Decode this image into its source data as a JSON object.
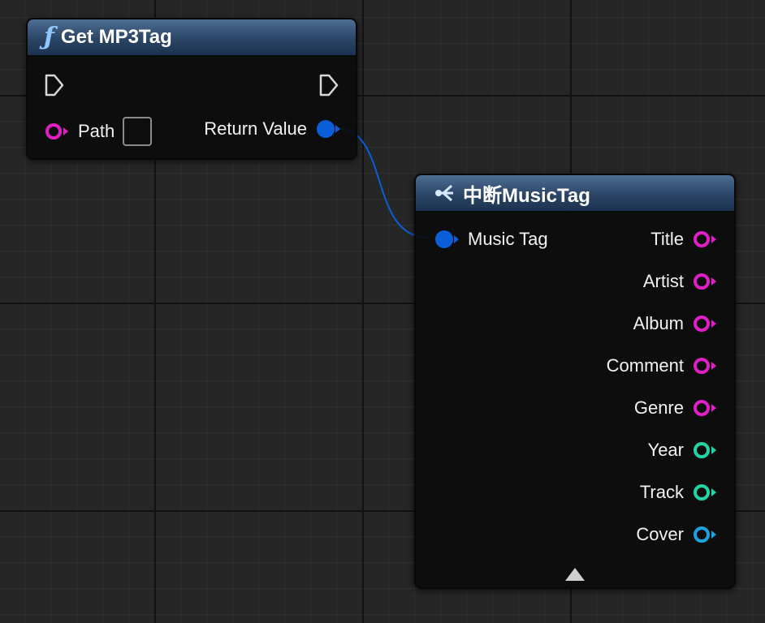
{
  "nodes": {
    "get_mp3tag": {
      "title": "Get MP3Tag",
      "icon": "function-icon",
      "header_color": "#2b4566",
      "inputs": [
        {
          "label": "Path",
          "type": "string",
          "color": "#e21ec6"
        }
      ],
      "outputs": [
        {
          "label": "Return Value",
          "type": "struct",
          "color": "#0a5fd8"
        }
      ]
    },
    "break_musictag": {
      "title": "中断MusicTag",
      "icon": "break-struct-icon",
      "inputs": [
        {
          "label": "Music Tag",
          "type": "struct",
          "color": "#0a5fd8"
        }
      ],
      "outputs": [
        {
          "label": "Title",
          "type": "string",
          "color": "#e21ec6"
        },
        {
          "label": "Artist",
          "type": "string",
          "color": "#e21ec6"
        },
        {
          "label": "Album",
          "type": "string",
          "color": "#e21ec6"
        },
        {
          "label": "Comment",
          "type": "string",
          "color": "#e21ec6"
        },
        {
          "label": "Genre",
          "type": "string",
          "color": "#e21ec6"
        },
        {
          "label": "Year",
          "type": "integer",
          "color": "#1fd6a6"
        },
        {
          "label": "Track",
          "type": "integer",
          "color": "#1fd6a6"
        },
        {
          "label": "Cover",
          "type": "object",
          "color": "#1aa3e0"
        }
      ],
      "collapse_icon": "collapse-arrow-icon"
    }
  },
  "colors": {
    "wire": "#0a5fd8",
    "exec_pin": "#d8d8d8"
  }
}
